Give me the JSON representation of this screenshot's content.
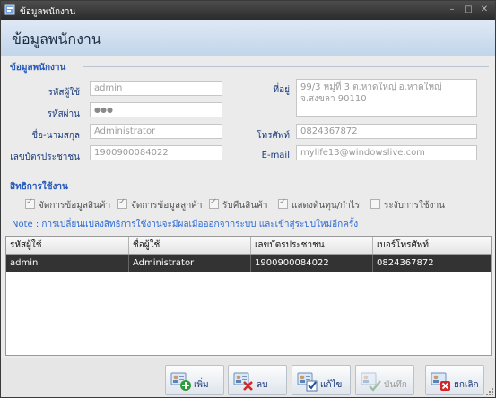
{
  "window": {
    "title": "ข้อมูลพนักงาน"
  },
  "header": {
    "title": "ข้อมูลพนักงาน"
  },
  "employee_group": {
    "title": "ข้อมูลพนักงาน",
    "username_label": "รหัสผู้ใช้",
    "username_value": "admin",
    "password_label": "รหัสผ่าน",
    "password_value": "●●●",
    "fullname_label": "ชื่อ-นามสกุล",
    "fullname_value": "Administrator",
    "idcard_label": "เลขบัตรประชาชน",
    "idcard_value": "1900900084022",
    "address_label": "ที่อยู่",
    "address_value": "99/3 หมู่ที่ 3 ต.หาดใหญ่ อ.หาดใหญ่ จ.สงขลา 90110",
    "phone_label": "โทรศัพท์",
    "phone_value": "0824367872",
    "email_label": "E-mail",
    "email_value": "mylife13@windowslive.com"
  },
  "permissions_group": {
    "title": "สิทธิการใช้งาน",
    "items": [
      {
        "label": "จัดการข้อมูลสินค้า",
        "checked": true
      },
      {
        "label": "จัดการข้อมูลลูกค้า",
        "checked": true
      },
      {
        "label": "รับคืนสินค้า",
        "checked": true
      },
      {
        "label": "แสดงต้นทุน/กำไร",
        "checked": true
      },
      {
        "label": "ระงับการใช้งาน",
        "checked": false
      }
    ],
    "note": "Note : การเปลี่ยนแปลงสิทธิการใช้งานจะมีผลเมื่อออกจากระบบ และเข้าสู่ระบบใหม่อีกครั้ง"
  },
  "table": {
    "columns": [
      "รหัสผู้ใช้",
      "ชื่อผู้ใช้",
      "เลขบัตรประชาชน",
      "เบอร์โทรศัพท์"
    ],
    "rows": [
      [
        "admin",
        "Administrator",
        "1900900084022",
        "0824367872"
      ]
    ]
  },
  "buttons": {
    "add": "เพิ่ม",
    "delete": "ลบ",
    "edit": "แก้ไข",
    "save": "บันทึก",
    "cancel": "ยกเลิก"
  },
  "colors": {
    "accent": "#2458b8",
    "selected_row": "#333333",
    "title_bar": "#3a3a3a"
  }
}
